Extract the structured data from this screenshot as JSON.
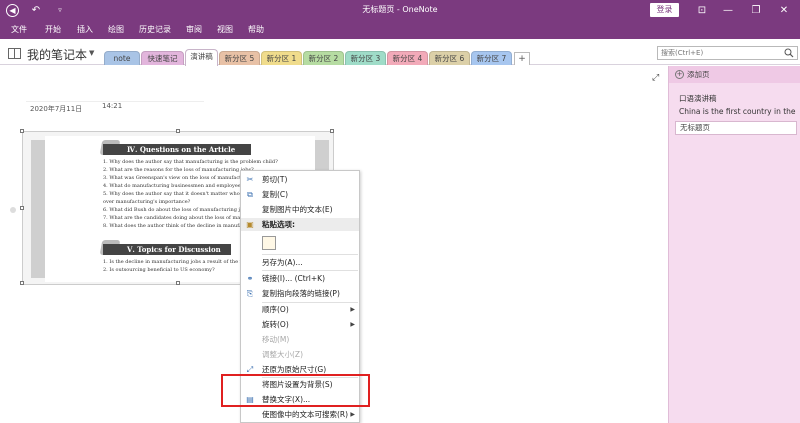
{
  "window": {
    "title": "无标题页 - OneNote",
    "login_label": "登录"
  },
  "menu": [
    "文件",
    "开始",
    "插入",
    "绘图",
    "历史记录",
    "审阅",
    "视图",
    "帮助"
  ],
  "notebook": {
    "name": "我的笔记本"
  },
  "tabs": [
    {
      "label": "note",
      "color": "#a9c4e6"
    },
    {
      "label": "快速笔记",
      "color": "#e2b5dc"
    },
    {
      "label": "演讲稿",
      "color": "#ffffff"
    },
    {
      "label": "新分区 5",
      "color": "#e8c1a6"
    },
    {
      "label": "新分区 1",
      "color": "#f0dc8c"
    },
    {
      "label": "新分区 2",
      "color": "#b6dca2"
    },
    {
      "label": "新分区 3",
      "color": "#9fdcc8"
    },
    {
      "label": "新分区 4",
      "color": "#f2aab9"
    },
    {
      "label": "新分区 6",
      "color": "#dcd0a8"
    },
    {
      "label": "新分区 7",
      "color": "#a7c6ef"
    }
  ],
  "tab_add_label": "+",
  "search": {
    "placeholder": "搜索(Ctrl+E)"
  },
  "page": {
    "date": "2020年7月11日",
    "time": "14:21"
  },
  "image_content": {
    "heading1": "Ⅳ. Questions on the Article",
    "questions": [
      "1. Why does the author say that manufacturing is the problem child?",
      "2. What are the reasons for the loss of manufacturing jobs?",
      "3. What was Greenspan's view on the loss of manufacturing jobs?",
      "4. What do manufacturing businessmen and employees think of it?",
      "5. Why does the author say that it doesn't matter who has the better",
      "   over manufacturing's importance?",
      "6. What did Bush do about the loss of manufacturing jobs?",
      "7. What are the candidates doing about the loss of manufacturing",
      "8. What does the author think of the decline in manufacturing jobs?"
    ],
    "heading2": "Ⅴ. Topics for Discussion",
    "topics": [
      "1. Is the decline in manufacturing jobs a result of the natural evol",
      "2. Is outsourcing beneficial to US economy?"
    ]
  },
  "context_menu": {
    "items": [
      {
        "label": "剪切(T)",
        "icon": "scissors-icon",
        "glyph": "✂",
        "disabled": false
      },
      {
        "label": "复制(C)",
        "icon": "copy-icon",
        "glyph": "⧉",
        "disabled": false
      },
      {
        "label": "复制图片中的文本(E)",
        "icon": "",
        "glyph": "",
        "disabled": false
      },
      {
        "label": "粘贴选项:",
        "icon": "paste-icon",
        "glyph": "📋",
        "disabled": false,
        "header": true
      },
      {
        "label": "另存为(A)...",
        "icon": "",
        "glyph": "",
        "disabled": false
      },
      {
        "label": "链接(I)...  (Ctrl+K)",
        "icon": "link-icon",
        "glyph": "🔗",
        "disabled": false
      },
      {
        "label": "复制指向段落的链接(P)",
        "icon": "link-paragraph-icon",
        "glyph": "⎘",
        "disabled": false
      },
      {
        "label": "顺序(O)",
        "icon": "",
        "glyph": "",
        "disabled": false,
        "submenu": true
      },
      {
        "label": "旋转(O)",
        "icon": "",
        "glyph": "",
        "disabled": false,
        "submenu": true
      },
      {
        "label": "移动(M)",
        "icon": "",
        "glyph": "",
        "disabled": true
      },
      {
        "label": "调整大小(Z)",
        "icon": "",
        "glyph": "",
        "disabled": true
      },
      {
        "label": "还原为原始尺寸(G)",
        "icon": "restore-size-icon",
        "glyph": "⤢",
        "disabled": false
      },
      {
        "label": "将图片设置为背景(S)",
        "icon": "",
        "glyph": "",
        "disabled": false
      },
      {
        "label": "替换文字(X)...",
        "icon": "alt-text-icon",
        "glyph": "▤",
        "disabled": false
      },
      {
        "label": "使图像中的文本可搜索(R)",
        "icon": "",
        "glyph": "",
        "disabled": false,
        "submenu": true
      }
    ]
  },
  "right_pane": {
    "add_page_label": "添加页",
    "pages": [
      "口语演讲稿",
      "China is the first country in the"
    ],
    "selected_page": "无标题页"
  }
}
